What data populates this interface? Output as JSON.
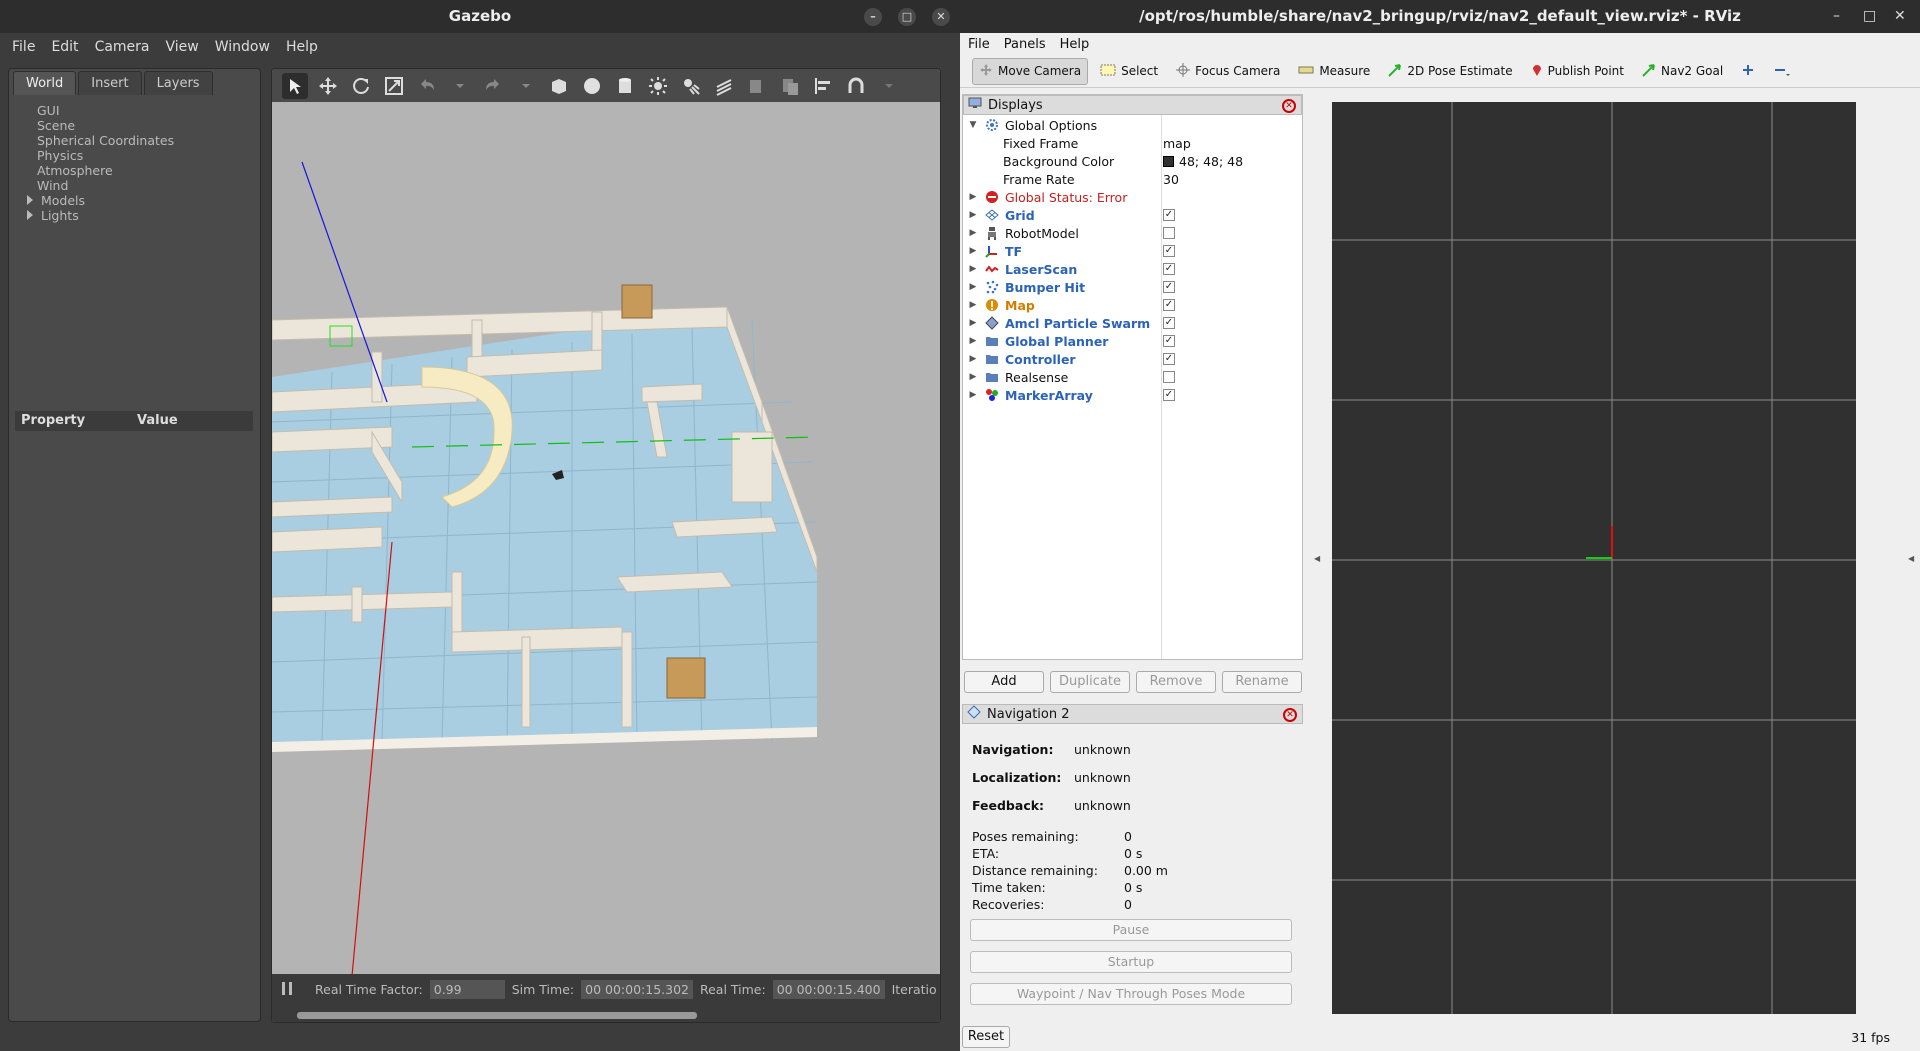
{
  "gazebo": {
    "title": "Gazebo",
    "menu": [
      "File",
      "Edit",
      "Camera",
      "View",
      "Window",
      "Help"
    ],
    "tabs": [
      "World",
      "Insert",
      "Layers"
    ],
    "tree": [
      "GUI",
      "Scene",
      "Spherical Coordinates",
      "Physics",
      "Atmosphere",
      "Wind"
    ],
    "tree_expandable": [
      "Models",
      "Lights"
    ],
    "property_header": {
      "property": "Property",
      "value": "Value"
    },
    "status": {
      "rtf_label": "Real Time Factor:",
      "rtf_value": "0.99",
      "sim_label": "Sim Time:",
      "sim_value": "00 00:00:15.302",
      "real_label": "Real Time:",
      "real_value": "00 00:00:15.400",
      "iter_label": "Iteratio"
    }
  },
  "rviz": {
    "title": "/opt/ros/humble/share/nav2_bringup/rviz/nav2_default_view.rviz* - RViz",
    "menu": [
      "File",
      "Panels",
      "Help"
    ],
    "tools": [
      "Move Camera",
      "Select",
      "Focus Camera",
      "Measure",
      "2D Pose Estimate",
      "Publish Point",
      "Nav2 Goal"
    ],
    "displays_title": "Displays",
    "global_options": {
      "label": "Global Options",
      "fixed_frame_label": "Fixed Frame",
      "fixed_frame": "map",
      "bg_label": "Background Color",
      "bg": "48; 48; 48",
      "fr_label": "Frame Rate",
      "fr": "30"
    },
    "global_status": "Global Status: Error",
    "displays": [
      {
        "name": "Grid",
        "checked": "✓"
      },
      {
        "name": "RobotModel",
        "checked": ""
      },
      {
        "name": "TF",
        "checked": "✓"
      },
      {
        "name": "LaserScan",
        "checked": "✓"
      },
      {
        "name": "Bumper Hit",
        "checked": "✓"
      },
      {
        "name": "Map",
        "checked": "✓"
      },
      {
        "name": "Amcl Particle Swarm",
        "checked": "✓"
      },
      {
        "name": "Global Planner",
        "checked": "✓"
      },
      {
        "name": "Controller",
        "checked": "✓"
      },
      {
        "name": "Realsense",
        "checked": ""
      },
      {
        "name": "MarkerArray",
        "checked": "✓"
      }
    ],
    "buttons": [
      "Add",
      "Duplicate",
      "Remove",
      "Rename"
    ],
    "nav_title": "Navigation 2",
    "nav": {
      "navigation_label": "Navigation:",
      "navigation": "unknown",
      "localization_label": "Localization:",
      "localization": "unknown",
      "feedback_label": "Feedback:",
      "feedback": "unknown",
      "poses_label": "Poses remaining:",
      "poses": "0",
      "eta_label": "ETA:",
      "eta": "0 s",
      "dist_label": "Distance remaining:",
      "dist": "0.00 m",
      "time_label": "Time taken:",
      "time": "0 s",
      "rec_label": "Recoveries:",
      "rec": "0"
    },
    "nav_buttons": [
      "Pause",
      "Startup",
      "Waypoint / Nav Through Poses Mode"
    ],
    "reset": "Reset",
    "fps": "31 fps"
  }
}
